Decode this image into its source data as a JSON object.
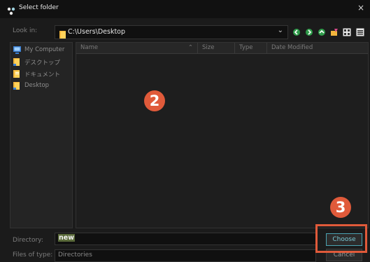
{
  "window": {
    "title": "Select folder",
    "close_glyph": "×"
  },
  "lookin": {
    "label": "Look in:",
    "path": "C:\\Users\\Desktop",
    "dropdown_glyph": "⌄",
    "toolbar_icons": [
      "back-icon",
      "forward-icon",
      "up-folder-icon",
      "new-folder-icon",
      "list-view-icon",
      "detail-view-icon"
    ]
  },
  "sidebar": {
    "items": [
      {
        "label": "My Computer",
        "icon": "computer-icon"
      },
      {
        "label": "デスクトップ",
        "icon": "folder-icon"
      },
      {
        "label": "ドキュメント",
        "icon": "folder-icon"
      },
      {
        "label": "Desktop",
        "icon": "folder-icon"
      }
    ]
  },
  "filelist": {
    "columns": {
      "name": "Name",
      "size": "Size",
      "type": "Type",
      "date": "Date Modified"
    },
    "sort_glyph": "⌃"
  },
  "annotations": {
    "step2": "2",
    "step3": "3"
  },
  "directory": {
    "label": "Directory:",
    "value": "new"
  },
  "filetype": {
    "label": "Files of type:",
    "value": "Directories"
  },
  "buttons": {
    "choose": "Choose",
    "cancel": "Cancel"
  },
  "colors": {
    "accent": "#4aa3b2",
    "annotation": "#e05a3a",
    "folder": "#f2b53c",
    "background": "#1b1b1b"
  }
}
